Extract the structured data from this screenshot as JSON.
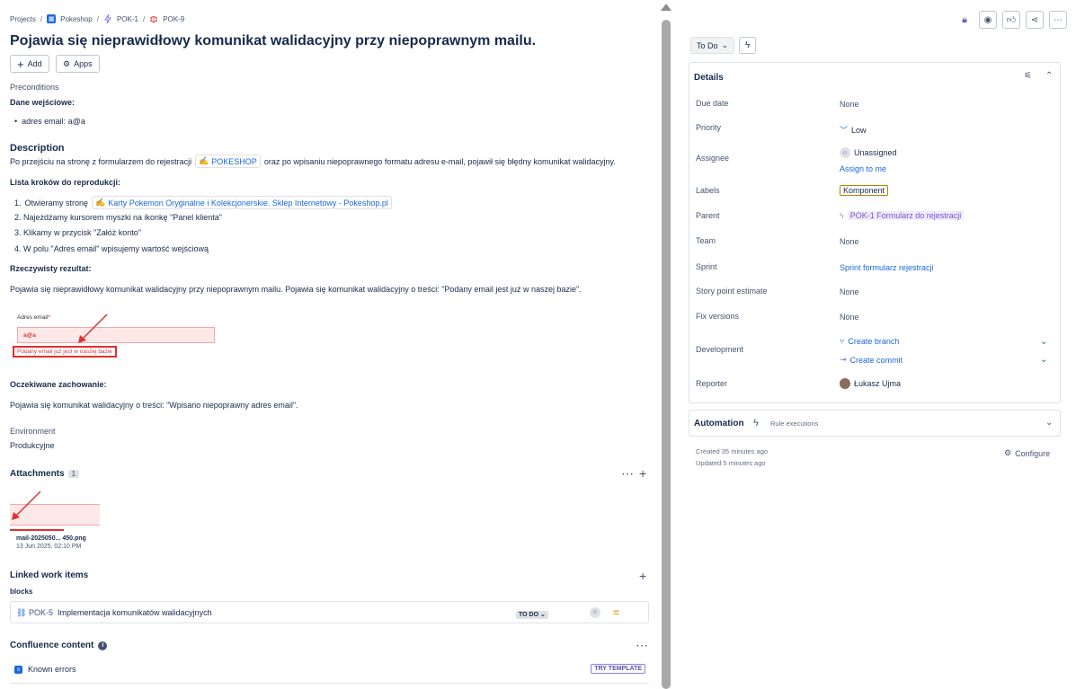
{
  "breadcrumb": {
    "projects": "Projects",
    "project": "Pokeshop",
    "parent": "POK-1",
    "issue": "POK-9"
  },
  "issue": {
    "title": "Pojawia się nieprawidłowy komunikat walidacyjny przy niepoprawnym mailu."
  },
  "actions": {
    "add": "Add",
    "apps": "Apps"
  },
  "preconditions": {
    "label": "Preconditions",
    "heading": "Dane wejściowe:",
    "item": "adres email: a@a"
  },
  "description": {
    "heading": "Description",
    "p1_before": "Po przejściu na stronę z formularzem do rejestracji",
    "p1_link": "POKESHOP",
    "p1_after": "oraz po wpisaniu niepoprawnego formatu adresu e-mail, pojawił się błędny komunikat walidacyjny.",
    "steps_heading": "Lista kroków do reprodukcji:",
    "step1_before": "Otwieramy stronę",
    "step1_link": "Karty Pokemon Oryginalne i Kolekcjonerskie. Sklep Internetowy - Pokeshop.pl",
    "step2": "Najeżdżamy kursorem myszki na ikonkę \"Panel klienta\"",
    "step3": "Klikamy w przycisk \"Załóż konto\"",
    "step4": "W polu \"Adres email\" wpisujemy wartość wejściową",
    "actual_heading": "Rzeczywisty rezultat:",
    "actual_text": "Pojawia się nieprawidłowy komunikat walidacyjny przy niepoprawnym mailu. Pojawia się komunikat walidacyjny o treści: \"Podany email jest już w naszej bazie\".",
    "screenshot": {
      "field_label": "Adres email",
      "required": "*",
      "field_value": "a@a",
      "error": "Podany email już jest w naszej bazie"
    },
    "expected_heading": "Oczekiwane zachowanie:",
    "expected_text": "Pojawia się komunikat walidacyjny o treści: \"Wpisano niepoprawny adres email\"."
  },
  "environment": {
    "label": "Environment",
    "value": "Produkcyjne"
  },
  "attachments": {
    "heading": "Attachments",
    "count": "1",
    "file_name": "mail-2025050... 450.png",
    "file_date": "13 Jun 2025, 02:10 PM"
  },
  "linked": {
    "heading": "Linked work items",
    "relation": "blocks",
    "item": {
      "key": "POK-5",
      "summary": "Implementacja komunikatów walidacyjnych",
      "status": "TO DO"
    }
  },
  "confluence": {
    "heading": "Confluence content",
    "item": "Known errors",
    "template": "TRY TEMPLATE"
  },
  "sidebar": {
    "status": "To Do",
    "details_heading": "Details",
    "fields": {
      "due_date": {
        "label": "Due date",
        "value": "None"
      },
      "priority": {
        "label": "Priority",
        "value": "Low"
      },
      "assignee": {
        "label": "Assignee",
        "value": "Unassigned",
        "action": "Assign to me"
      },
      "labels": {
        "label": "Labels",
        "value": "Komponent"
      },
      "parent": {
        "label": "Parent",
        "value": "POK-1 Formularz do rejestracji"
      },
      "team": {
        "label": "Team",
        "value": "None"
      },
      "sprint": {
        "label": "Sprint",
        "value": "Sprint formularz rejestracji"
      },
      "story_points": {
        "label": "Story point estimate",
        "value": "None"
      },
      "fix_versions": {
        "label": "Fix versions",
        "value": "None"
      },
      "development": {
        "label": "Development",
        "branch": "Create branch",
        "commit": "Create commit"
      },
      "reporter": {
        "label": "Reporter",
        "value": "Łukasz Ujma"
      }
    },
    "automation": {
      "heading": "Automation",
      "sub": "Rule executions"
    },
    "created": "Created 35 minutes ago",
    "updated": "Updated 5 minutes ago",
    "configure": "Configure"
  },
  "colors": {
    "link": "#1868db",
    "text": "#172b4d",
    "subtle": "#44546f",
    "error": "#e03030",
    "discovery": "#6e5dc6"
  }
}
